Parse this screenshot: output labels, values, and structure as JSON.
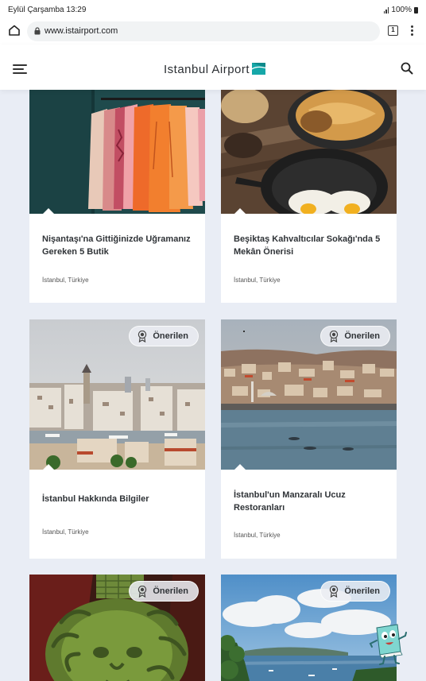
{
  "status_bar": {
    "time": "Eylül Çarşamba 13:29",
    "battery": "100%"
  },
  "browser": {
    "url": "www.istairport.com",
    "tab_count": "1"
  },
  "header": {
    "logo_text": "Istanbul Airport",
    "brand_color": "#16a7a8"
  },
  "cards": [
    {
      "title": "Nişantaşı'na Gittiğinizde Uğramanız Gereken 5 Butik",
      "location": "İstanbul, Türkiye",
      "badge": ""
    },
    {
      "title": "Beşiktaş Kahvaltıcılar Sokağı'nda 5 Mekân Önerisi",
      "location": "İstanbul, Türkiye",
      "badge": ""
    },
    {
      "title": "İstanbul Hakkında Bilgiler",
      "location": "İstanbul, Türkiye",
      "badge": "Önerilen"
    },
    {
      "title": "İstanbul'un Manzaralı Ucuz Restoranları",
      "location": "İstanbul, Türkiye",
      "badge": "Önerilen"
    },
    {
      "title": "",
      "location": "",
      "badge": "Önerilen"
    },
    {
      "title": "",
      "location": "",
      "badge": "Önerilen"
    }
  ],
  "icons": {
    "home": "home-icon",
    "lock": "lock-icon",
    "tabs": "tabs-icon",
    "menu": "more-vert-icon",
    "hamburger": "hamburger-menu-icon",
    "search": "search-icon",
    "badge": "award-ribbon-icon",
    "mascot": "mascot-icon"
  }
}
